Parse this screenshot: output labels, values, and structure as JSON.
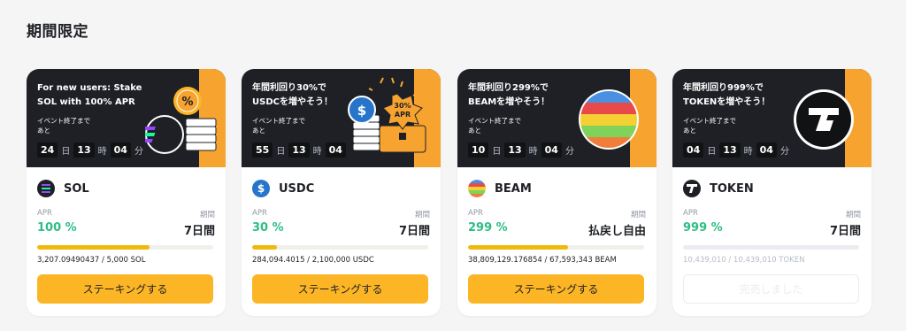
{
  "section_title": "期間限定",
  "labels": {
    "apr": "APR",
    "period": "期間"
  },
  "cards": [
    {
      "banner_line1": "For new users: Stake",
      "banner_line2": "SOL with 100% APR",
      "ends_line1": "イベント終了まで",
      "ends_line2": "あと",
      "cd": [
        {
          "v": "24",
          "u": "日"
        },
        {
          "v": "13",
          "u": "時"
        },
        {
          "v": "04",
          "u": "分"
        }
      ],
      "token": "SOL",
      "apr": "100 %",
      "period": "7日間",
      "progress": 0.64,
      "amount": "3,207.09490437 / 5,000 SOL",
      "button": "ステーキングする",
      "art_icon": "sol-icon"
    },
    {
      "banner_line1": "年間利回り30%で",
      "banner_line2": "USDCを増やそう！",
      "ends_line1": "イベント終了まで",
      "ends_line2": "あと",
      "cd": [
        {
          "v": "55",
          "u": "日"
        },
        {
          "v": "13",
          "u": "時"
        },
        {
          "v": "04",
          "u": ""
        }
      ],
      "token": "USDC",
      "apr": "30 %",
      "period": "7日間",
      "progress": 0.14,
      "amount": "284,094.4015 / 2,100,000 USDC",
      "button": "ステーキングする",
      "art_badge": "30% APR"
    },
    {
      "banner_line1": "年間利回り299%で",
      "banner_line2": "BEAMを増やそう！",
      "ends_line1": "イベント終了まで",
      "ends_line2": "あと",
      "cd": [
        {
          "v": "10",
          "u": "日"
        },
        {
          "v": "13",
          "u": "時"
        },
        {
          "v": "04",
          "u": "分"
        }
      ],
      "token": "BEAM",
      "apr": "299 %",
      "period": "払戻し自由",
      "progress": 0.57,
      "amount": "38,809,129.176854 / 67,593,343 BEAM",
      "button": "ステーキングする"
    },
    {
      "banner_line1": "年間利回り999%で",
      "banner_line2": "TOKENを増やそう！",
      "ends_line1": "イベント終了まで",
      "ends_line2": "あと",
      "cd": [
        {
          "v": "04",
          "u": "日"
        },
        {
          "v": "13",
          "u": "時"
        },
        {
          "v": "04",
          "u": "分"
        }
      ],
      "token": "TOKEN",
      "apr": "999 %",
      "period": "7日間",
      "progress": 1.0,
      "amount": "10,439,010 / 10,439,010 TOKEN",
      "button": "完売しました",
      "sold_out": true
    }
  ],
  "colors": {
    "accent": "#f7a32f",
    "button": "#fcb525",
    "apr_green": "#2ebd85",
    "banner_bg": "#1e2026"
  }
}
